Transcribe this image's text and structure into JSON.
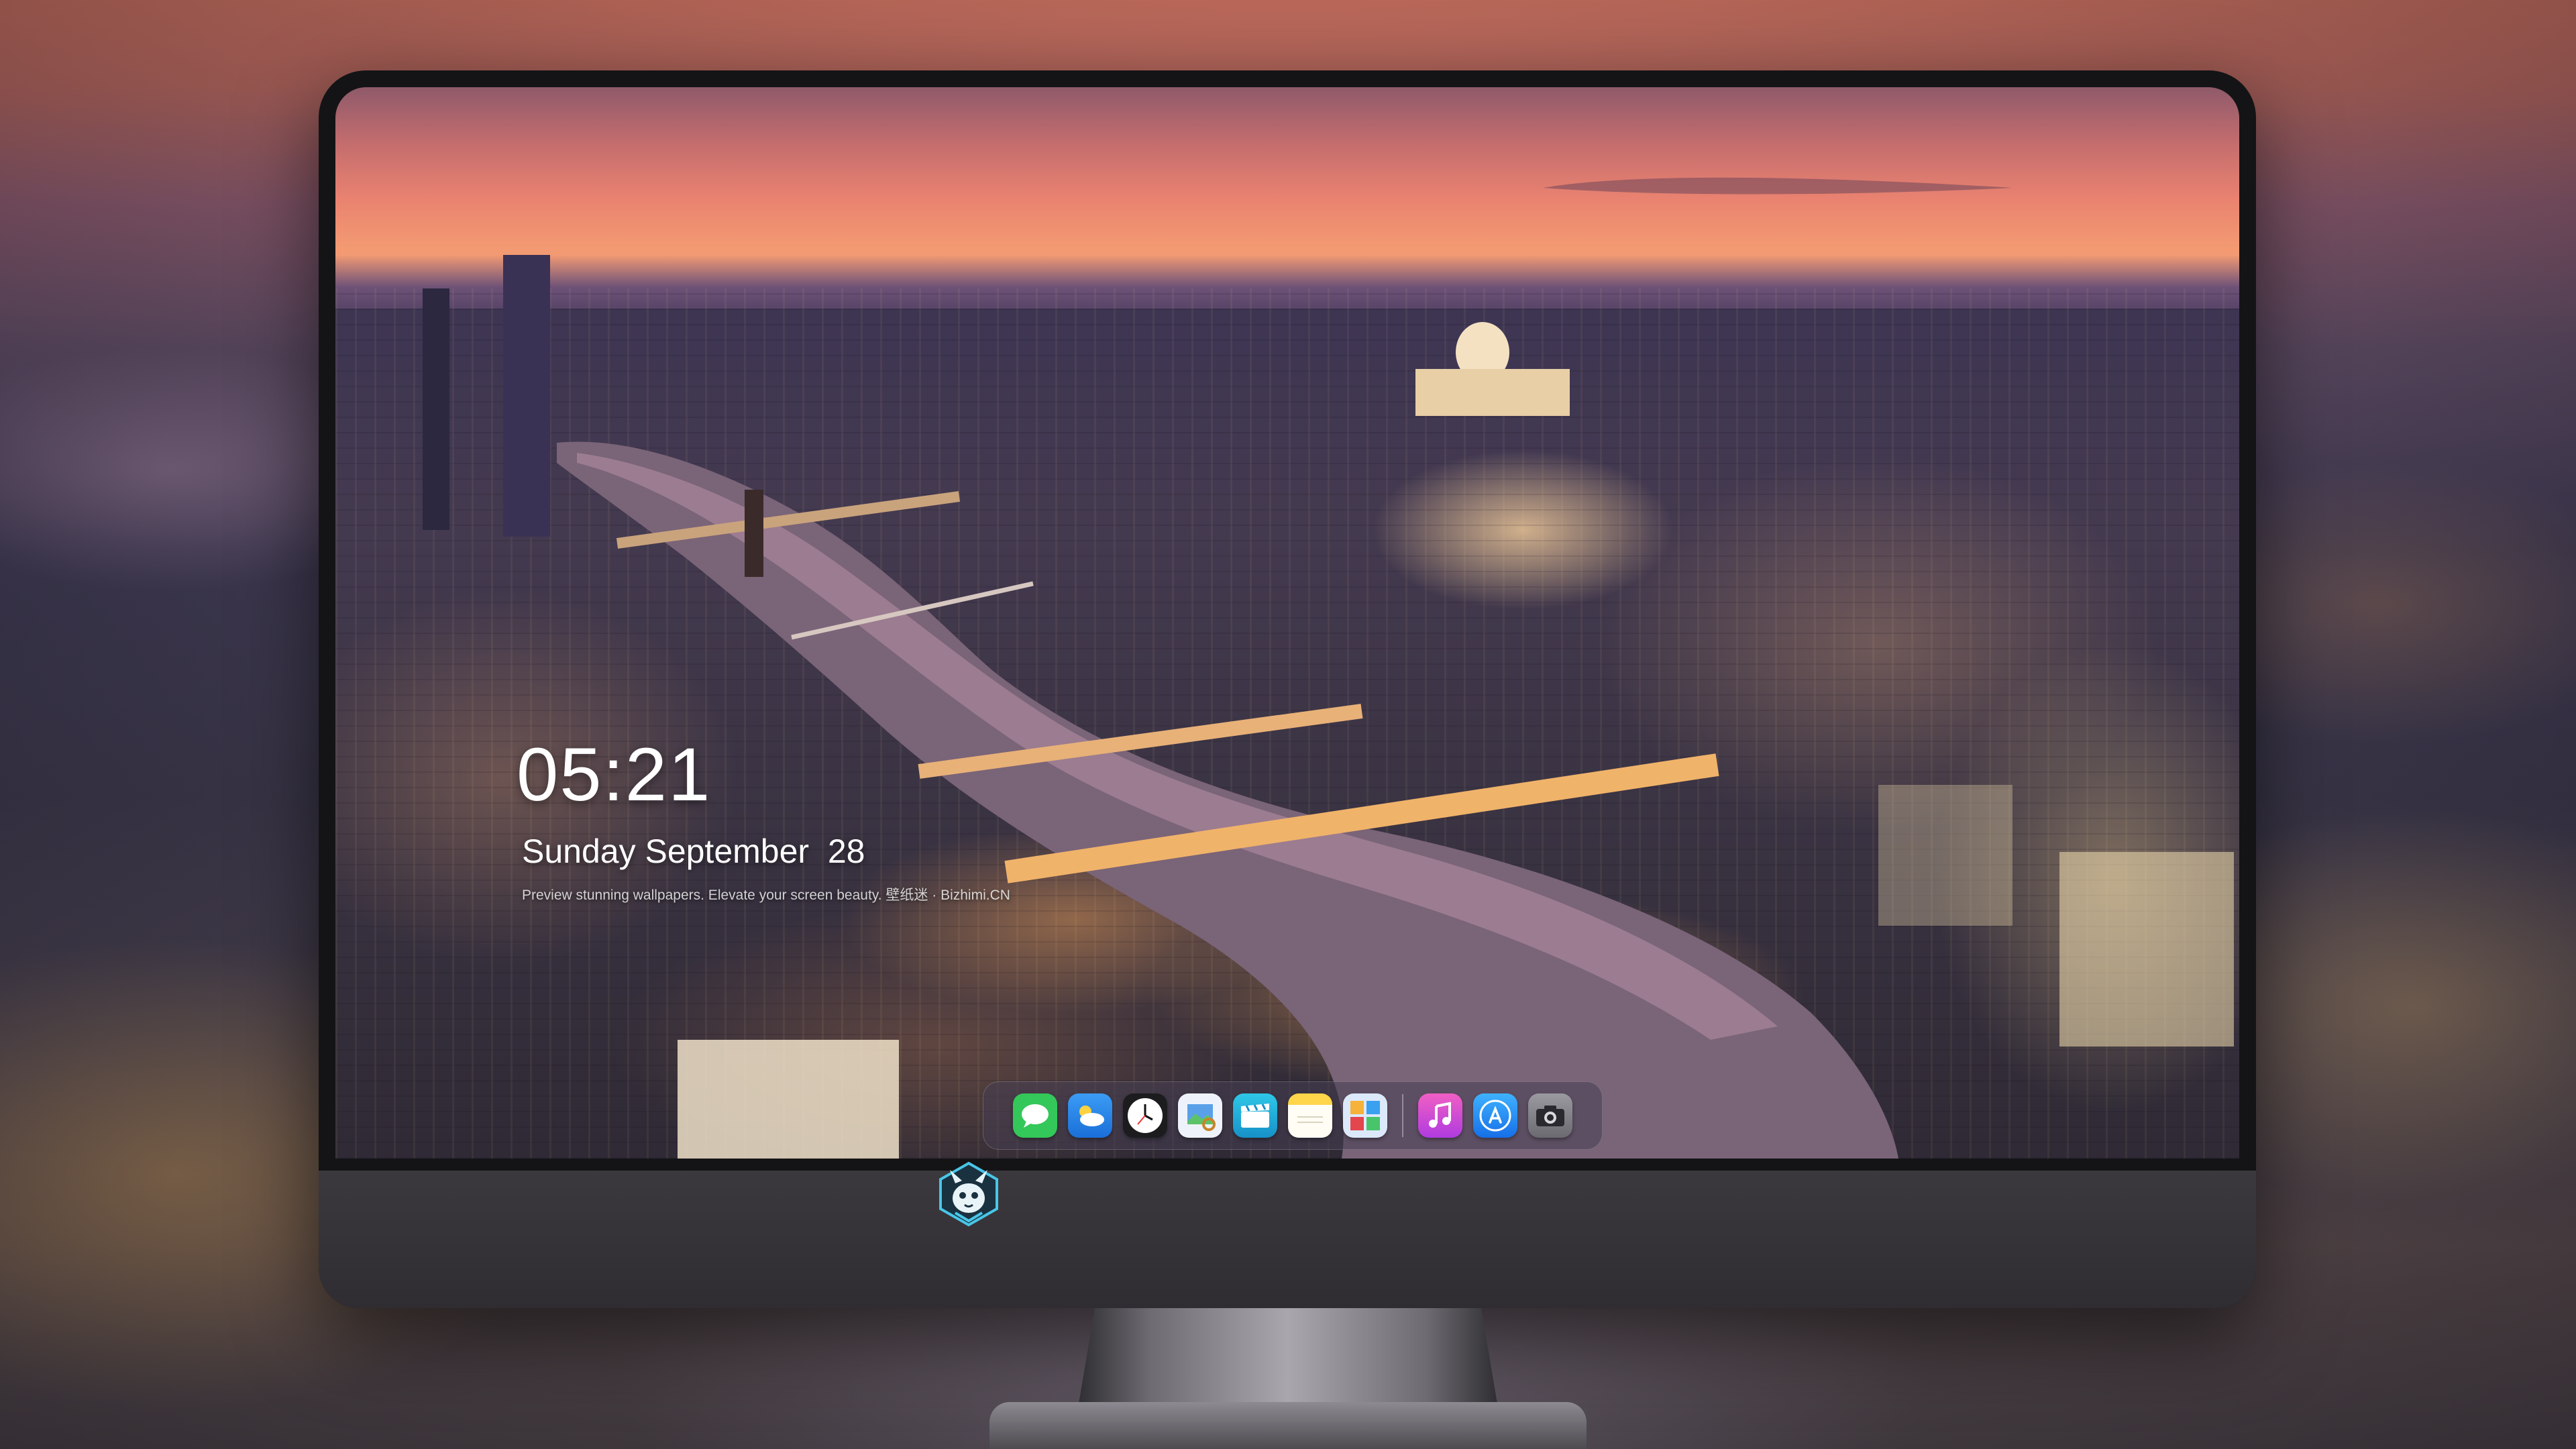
{
  "lockscreen": {
    "time": "05:21",
    "date": "Sunday September  28",
    "tagline": "Preview stunning wallpapers. Elevate your screen beauty. 壁纸迷 · Bizhimi.CN"
  },
  "dock": {
    "apps": [
      {
        "name": "messages-app-icon",
        "color": "#34c759"
      },
      {
        "name": "weather-app-icon",
        "color": "#3a8ef0"
      },
      {
        "name": "clock-app-icon",
        "color": "#ffffff"
      },
      {
        "name": "preview-app-icon",
        "color": "#e8f0ff"
      },
      {
        "name": "clips-app-icon",
        "color": "#1fb7d8"
      },
      {
        "name": "notes-app-icon",
        "color": "#ffd54a"
      },
      {
        "name": "photo-booth-app-icon",
        "color": "#d8e8ff"
      },
      {
        "name": "music-app-icon",
        "color": "#e34db7"
      },
      {
        "name": "app-store-icon",
        "color": "#2a8cf5"
      },
      {
        "name": "camera-app-icon",
        "color": "#8a8a8e"
      }
    ]
  },
  "device": {
    "logo": "dragon-mascot-logo"
  }
}
